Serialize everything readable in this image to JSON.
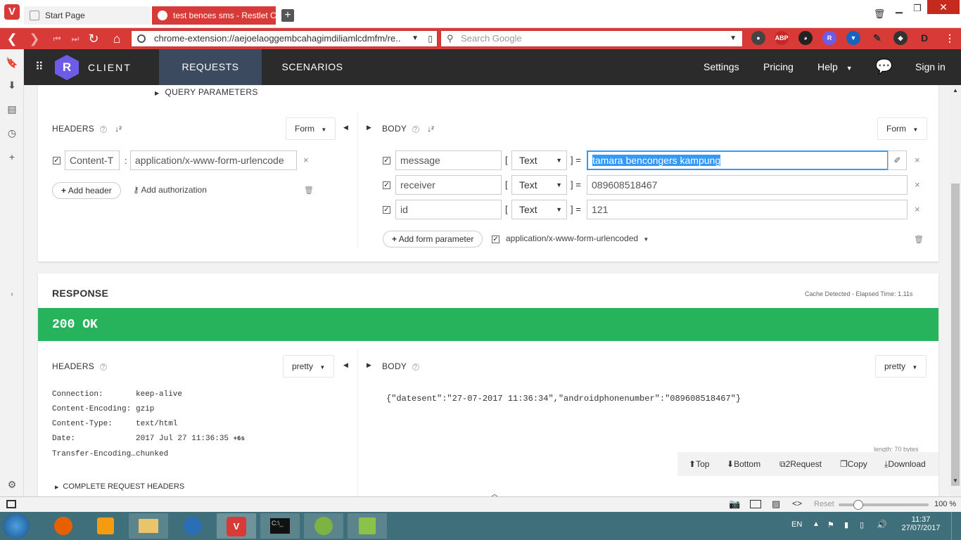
{
  "browser": {
    "tabs": [
      {
        "label": "Start Page"
      },
      {
        "label": "test bences sms - Restlet Cli"
      }
    ],
    "url": "chrome-extension://aejoelaoggembcahagimdiliamlcdmfm/re..",
    "search_placeholder": "Search Google",
    "extensions": [
      "ABP",
      "R"
    ]
  },
  "app": {
    "logo_letter": "R",
    "name": "CLIENT",
    "nav_tabs": [
      {
        "label": "REQUESTS"
      },
      {
        "label": "SCENARIOS"
      }
    ],
    "nav_right": [
      {
        "label": "Settings"
      },
      {
        "label": "Pricing"
      },
      {
        "label": "Help"
      },
      {
        "label": "Sign in"
      }
    ]
  },
  "request": {
    "query_params_label": "QUERY PARAMETERS",
    "headers": {
      "title": "HEADERS",
      "mode": "Form",
      "items": [
        {
          "name": "Content-T",
          "value": "application/x-www-form-urlencode"
        }
      ],
      "add_header": "Add header",
      "add_authorization": "Add authorization"
    },
    "body": {
      "title": "BODY",
      "mode": "Form",
      "params": [
        {
          "name": "message",
          "type": "Text",
          "value": "tamara bencongers kampung"
        },
        {
          "name": "receiver",
          "type": "Text",
          "value": "089608518467"
        },
        {
          "name": "id",
          "type": "Text",
          "value": "121"
        }
      ],
      "add_param": "Add form parameter",
      "content_type": "application/x-www-form-urlencoded"
    }
  },
  "response": {
    "title": "RESPONSE",
    "cache_info": "Cache Detected - Elapsed Time: 1.11s",
    "status": "200 OK",
    "status_color": "#27b35c",
    "headers": {
      "title": "HEADERS",
      "mode": "pretty",
      "items": [
        {
          "name": "Connection:",
          "value": "keep-alive"
        },
        {
          "name": "Content-Encoding:",
          "value": "gzip"
        },
        {
          "name": "Content-Type:",
          "value": "text/html"
        },
        {
          "name": "Date:",
          "value": "2017 Jul 27 11:36:35",
          "extra": "+6s"
        },
        {
          "name": "Transfer-Encoding…",
          "value": "chunked"
        }
      ],
      "complete_label": "COMPLETE REQUEST HEADERS"
    },
    "body": {
      "title": "BODY",
      "mode": "pretty",
      "content": "{\"datesent\":\"27-07-2017 11:36:34\",\"androidphonenumber\":\"089608518467\"}",
      "length": "length: 70 bytes"
    },
    "actions": [
      {
        "label": "Top"
      },
      {
        "label": "Bottom"
      },
      {
        "label": "2Request"
      },
      {
        "label": "Copy"
      },
      {
        "label": "Download"
      }
    ]
  },
  "statusbar": {
    "reset": "Reset",
    "zoom": "100 %",
    "zoom_fraction": 0.22
  },
  "taskbar": {
    "lang": "EN",
    "time": "11:37",
    "date": "27/07/2017"
  }
}
